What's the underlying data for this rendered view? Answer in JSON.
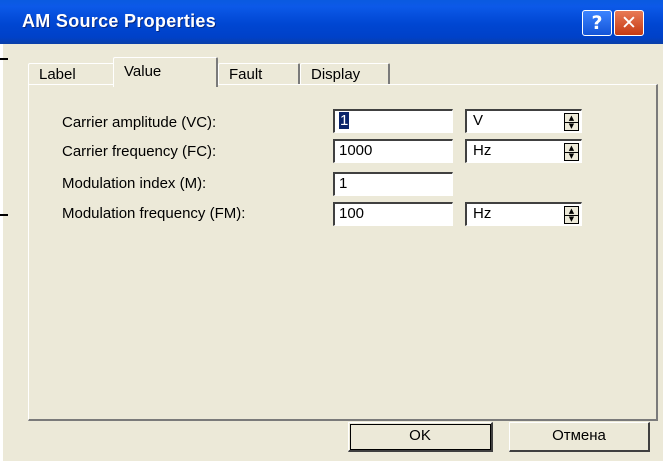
{
  "window": {
    "title": "AM Source Properties",
    "help_glyph": "?",
    "close_glyph": "✕"
  },
  "tabs": [
    {
      "label": "Label"
    },
    {
      "label": "Value"
    },
    {
      "label": "Fault"
    },
    {
      "label": "Display"
    }
  ],
  "active_tab": "Value",
  "fields": {
    "carrier_amplitude": {
      "label": "Carrier amplitude (VC):",
      "value": "1",
      "unit": "V"
    },
    "carrier_frequency": {
      "label": "Carrier frequency (FC):",
      "value": "1000",
      "unit": "Hz"
    },
    "modulation_index": {
      "label": "Modulation index (M):",
      "value": "1"
    },
    "modulation_frequency": {
      "label": "Modulation frequency (FM):",
      "value": "100",
      "unit": "Hz"
    }
  },
  "buttons": {
    "ok": "OK",
    "cancel": "Отмена"
  },
  "colors": {
    "titlebar": "#0046d2",
    "dialog_face": "#ece9d8",
    "selection": "#0a246a"
  },
  "icons": {
    "help": "help-icon",
    "close": "close-icon",
    "spin_up": "spin-up-icon",
    "spin_down": "spin-down-icon"
  }
}
